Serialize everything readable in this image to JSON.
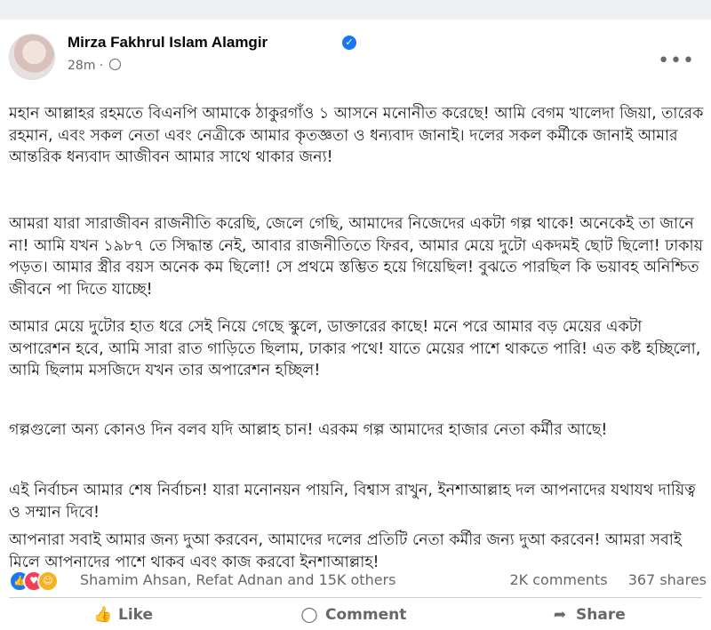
{
  "post": {
    "author": "Mirza Fakhrul Islam Alamgir",
    "time": "28m",
    "menu": "•••",
    "paragraphs": [
      "মহান আল্লাহর রহমতে বিএনপি আমাকে ঠাকুরগাঁও ১ আসনে মনোনীত করেছে! আমি বেগম খালেদা জিয়া, তারেক রহমান, এবং সকল নেতা এবং নেত্রীকে আমার কৃতজ্ঞতা ও ধন্যবাদ জানাই। দলের সকল কর্মীকে জানাই আমার আন্তরিক ধন্যবাদ আজীবন আমার সাথে থাকার জন্য!",
      "আমরা যারা সারাজীবন রাজনীতি করেছি, জেলে গেছি, আমাদের নিজেদের একটা গল্প থাকে! অনেকেই তা জানে না! আমি যখন ১৯৮৭ তে সিদ্ধান্ত নেই, আবার রাজনীতিতে ফিরব, আমার মেয়ে দুটো একদমই ছোট ছিলো! ঢাকায় পড়ত। আমার স্ত্রীর বয়স অনেক কম ছিলো! সে প্রথমে স্তম্ভিত হয়ে গিয়েছিল! বুঝতে পারছিল কি ভয়াবহ অনিশ্চিত জীবনে পা দিতে যাচ্ছে!",
      "আমার মেয়ে দুটোর হাত ধরে সেই নিয়ে গেছে স্কুলে, ডাক্তারের কাছে! মনে পরে আমার বড় মেয়ের একটা অপারেশন হবে, আমি সারা রাত গাড়িতে ছিলাম, ঢাকার পথে! যাতে মেয়ের পাশে থাকতে পারি! এত কষ্ট হচ্ছিলো, আমি ছিলাম মসজিদে যখন তার অপারেশন হচ্ছিল!",
      "গল্পগুলো অন্য কোনও দিন বলব যদি আল্লাহ চান! এরকম গল্প আমাদের হাজার নেতা কর্মীর আছে!",
      "এই নির্বাচন আমার শেষ নির্বাচন! যারা মনোনয়ন পায়নি, বিশ্বাস রাখুন, ইনশাআল্লাহ দল আপনাদের যথাযথ দায়িত্ব ও সম্মান দিবে!",
      "আপনারা সবাই আমার জন্য দুআ করবেন, আমাদের দলের প্রতিটি নেতা কর্মীর জন্য দুআ করবেন! আমরা সবাই মিলে আপনাদের পাশে থাকব এবং কাজ করবো ইনশাআল্লাহ!"
    ]
  },
  "reactions": {
    "names": "Shamim Ahsan, Refat Adnan and 15K others",
    "comments": "2K comments",
    "shares": "367 shares",
    "icons": [
      "like-icon",
      "love-icon",
      "haha-icon"
    ]
  },
  "actions": {
    "like": "Like",
    "comment": "Comment",
    "share": "Share"
  },
  "colors": {
    "accent": "#1877f2",
    "secondary_text": "#65676b"
  }
}
